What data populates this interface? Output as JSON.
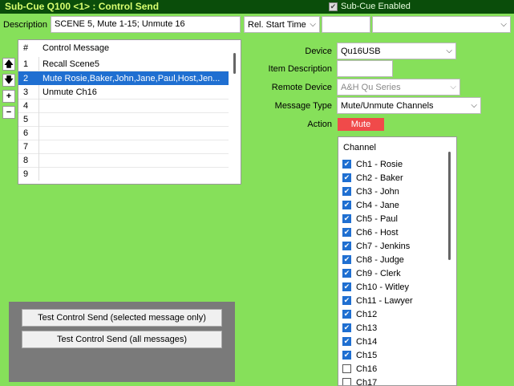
{
  "header": {
    "title": "Sub-Cue Q100 <1> : Control Send",
    "sub_cue_enabled_label": "Sub-Cue Enabled",
    "sub_cue_enabled": true
  },
  "description": {
    "label": "Description",
    "value": "SCENE 5, Mute 1-15; Unmute 16"
  },
  "timing": {
    "mode": "Rel. Start Time",
    "value": "",
    "extra": ""
  },
  "messages": {
    "columns": [
      "#",
      "Control Message"
    ],
    "rows": [
      {
        "num": "1",
        "text": "Recall Scene5"
      },
      {
        "num": "2",
        "text": "Mute Rosie,Baker,John,Jane,Paul,Host,Jen..."
      },
      {
        "num": "3",
        "text": "Unmute Ch16"
      },
      {
        "num": "4",
        "text": ""
      },
      {
        "num": "5",
        "text": ""
      },
      {
        "num": "6",
        "text": ""
      },
      {
        "num": "7",
        "text": ""
      },
      {
        "num": "8",
        "text": ""
      },
      {
        "num": "9",
        "text": ""
      }
    ],
    "selected_row": "2"
  },
  "side_buttons": {
    "up": "🡅",
    "down": "🡇",
    "add": "+",
    "remove": "−"
  },
  "test": {
    "selected_label": "Test Control Send (selected message only)",
    "all_label": "Test Control Send (all messages)"
  },
  "properties": {
    "device_label": "Device",
    "device_value": "Qu16USB",
    "item_description_label": "Item Description",
    "item_description_value": "",
    "remote_device_label": "Remote Device",
    "remote_device_value": "A&H Qu Series",
    "message_type_label": "Message Type",
    "message_type_value": "Mute/Unmute Channels",
    "action_label": "Action",
    "action_value": "Mute",
    "action_color": "#f04a4a"
  },
  "channels": {
    "header": "Channel",
    "items": [
      {
        "label": "Ch1 - Rosie",
        "checked": true
      },
      {
        "label": "Ch2 - Baker",
        "checked": true
      },
      {
        "label": "Ch3 - John",
        "checked": true
      },
      {
        "label": "Ch4 - Jane",
        "checked": true
      },
      {
        "label": "Ch5 - Paul",
        "checked": true
      },
      {
        "label": "Ch6 - Host",
        "checked": true
      },
      {
        "label": "Ch7 - Jenkins",
        "checked": true
      },
      {
        "label": "Ch8 - Judge",
        "checked": true
      },
      {
        "label": "Ch9 - Clerk",
        "checked": true
      },
      {
        "label": "Ch10 - Witley",
        "checked": true
      },
      {
        "label": "Ch11 - Lawyer",
        "checked": true
      },
      {
        "label": "Ch12",
        "checked": true
      },
      {
        "label": "Ch13",
        "checked": true
      },
      {
        "label": "Ch14",
        "checked": true
      },
      {
        "label": "Ch15",
        "checked": true
      },
      {
        "label": "Ch16",
        "checked": false
      },
      {
        "label": "Ch17",
        "checked": false
      }
    ]
  },
  "colors": {
    "background": "#86e05a",
    "header_bg": "#0a4d0a",
    "header_text": "#d8ff70",
    "selection": "#1f6fd1",
    "test_panel": "#7a7a7a"
  }
}
